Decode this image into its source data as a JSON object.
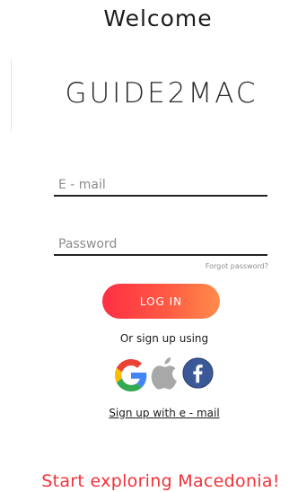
{
  "header": {
    "title": "Welcome"
  },
  "brand": {
    "logo_text": "GUIDE2MAC"
  },
  "form": {
    "email_placeholder": "E - mail",
    "email_value": "",
    "password_placeholder": "Password",
    "password_value": "",
    "forgot_label": "Forgot password?",
    "login_label": "LOG IN"
  },
  "social": {
    "prompt": "Or sign up using",
    "providers": [
      "google-icon",
      "apple-icon",
      "facebook-icon"
    ]
  },
  "signup": {
    "email_link": "Sign up with e - mail"
  },
  "footer": {
    "tagline": "Start exploring Macedonia!"
  },
  "colors": {
    "accent_start": "#ff2e44",
    "accent_end": "#ff8c4a",
    "tagline": "#f2323a",
    "facebook": "#3b5998",
    "apple": "#a8a8a8"
  }
}
